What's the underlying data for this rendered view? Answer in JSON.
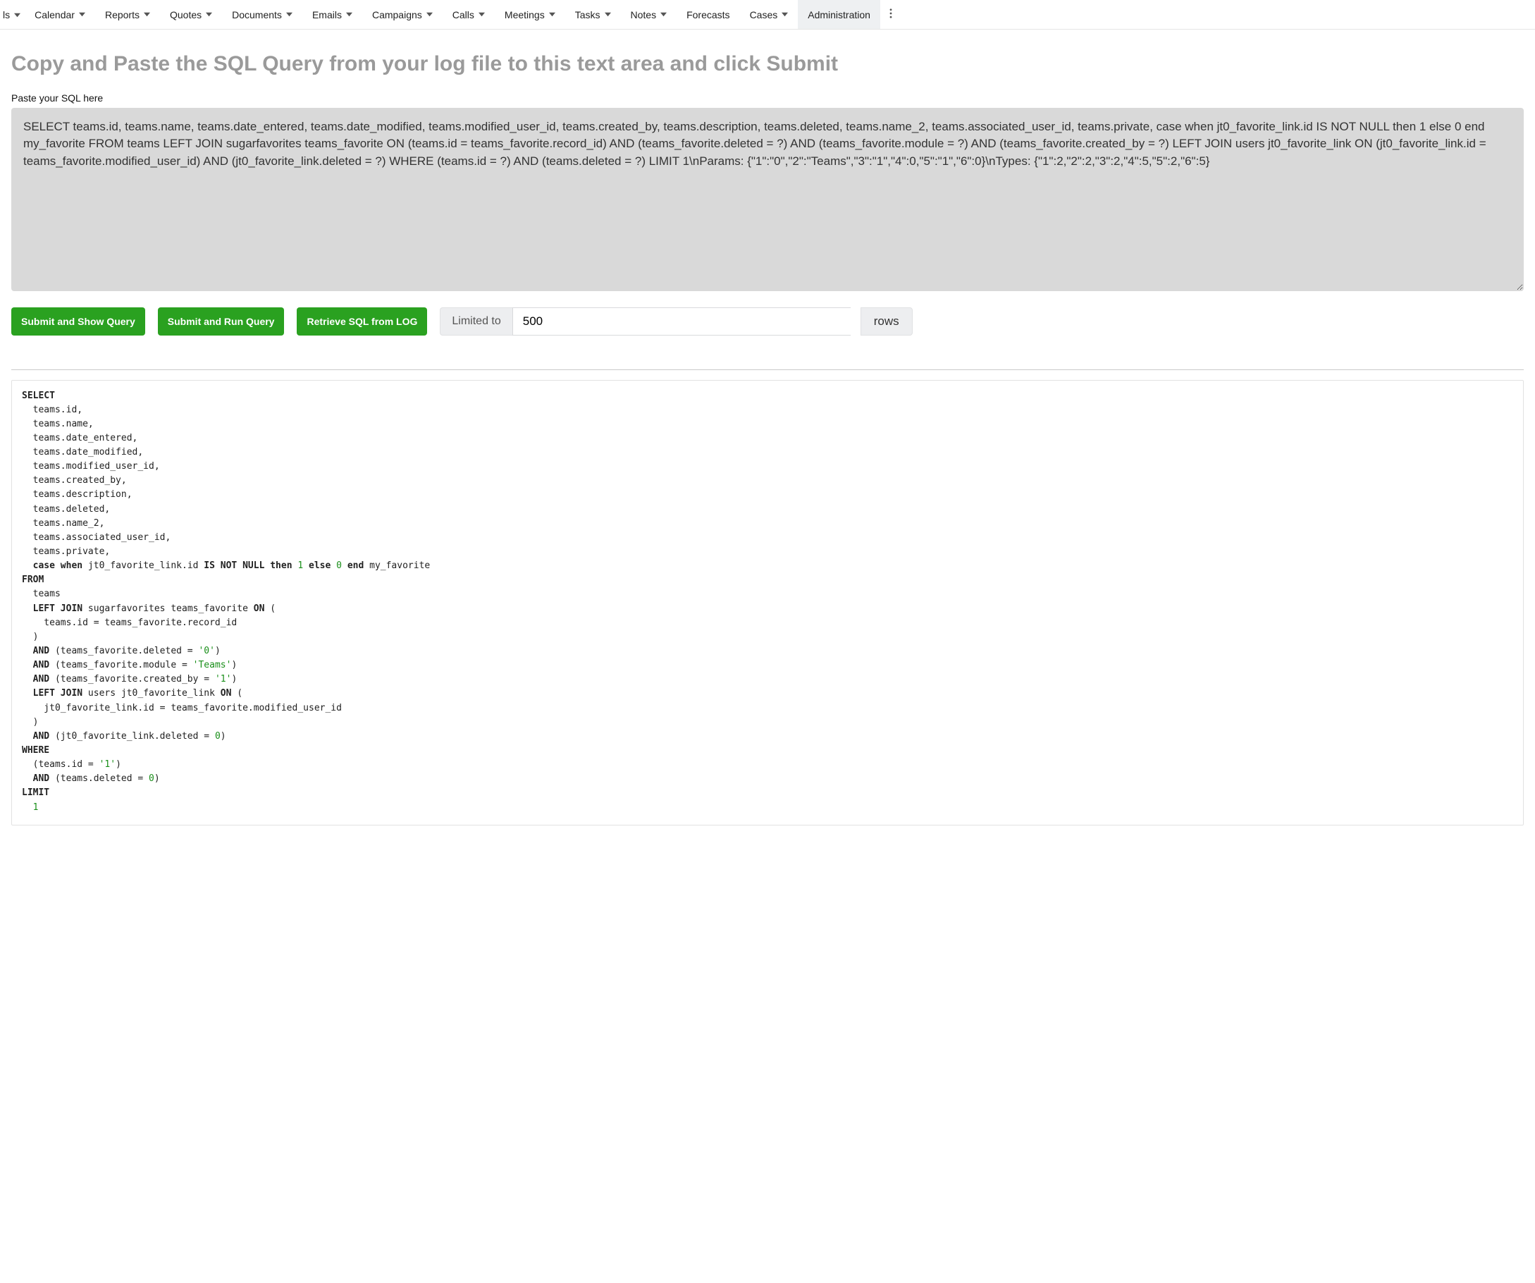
{
  "nav": {
    "partial": "ls",
    "items": [
      {
        "label": "Calendar",
        "caret": true
      },
      {
        "label": "Reports",
        "caret": true
      },
      {
        "label": "Quotes",
        "caret": true
      },
      {
        "label": "Documents",
        "caret": true
      },
      {
        "label": "Emails",
        "caret": true
      },
      {
        "label": "Campaigns",
        "caret": true
      },
      {
        "label": "Calls",
        "caret": true
      },
      {
        "label": "Meetings",
        "caret": true
      },
      {
        "label": "Tasks",
        "caret": true
      },
      {
        "label": "Notes",
        "caret": true
      },
      {
        "label": "Forecasts",
        "caret": false
      },
      {
        "label": "Cases",
        "caret": true
      },
      {
        "label": "Administration",
        "caret": false,
        "active": true
      }
    ]
  },
  "header": {
    "title": "Copy and Paste the SQL Query from your log file to this text area and click Submit"
  },
  "field": {
    "label": "Paste your SQL here",
    "value": "SELECT teams.id, teams.name, teams.date_entered, teams.date_modified, teams.modified_user_id, teams.created_by, teams.description, teams.deleted, teams.name_2, teams.associated_user_id, teams.private, case when jt0_favorite_link.id IS NOT NULL then 1 else 0 end my_favorite FROM teams LEFT JOIN sugarfavorites teams_favorite ON (teams.id = teams_favorite.record_id) AND (teams_favorite.deleted = ?) AND (teams_favorite.module = ?) AND (teams_favorite.created_by = ?) LEFT JOIN users jt0_favorite_link ON (jt0_favorite_link.id = teams_favorite.modified_user_id) AND (jt0_favorite_link.deleted = ?) WHERE (teams.id = ?) AND (teams.deleted = ?) LIMIT 1\\nParams: {\"1\":\"0\",\"2\":\"Teams\",\"3\":\"1\",\"4\":0,\"5\":\"1\",\"6\":0}\\nTypes: {\"1\":2,\"2\":2,\"3\":2,\"4\":5,\"5\":2,\"6\":5}"
  },
  "actions": {
    "submit_show": "Submit and Show Query",
    "submit_run": "Submit and Run Query",
    "retrieve": "Retrieve SQL from LOG",
    "limited_to": "Limited to",
    "limit_value": "500",
    "rows": "rows"
  },
  "sql_output": {
    "line1": "SELECT",
    "cols": [
      "  teams.id,",
      "  teams.name,",
      "  teams.date_entered,",
      "  teams.date_modified,",
      "  teams.modified_user_id,",
      "  teams.created_by,",
      "  teams.description,",
      "  teams.deleted,",
      "  teams.name_2,",
      "  teams.associated_user_id,",
      "  teams.private,"
    ],
    "case_prefix": "  ",
    "case_kw1": "case when",
    "case_mid": " jt0_favorite_link.id ",
    "case_kw2": "IS NOT NULL then",
    "case_sp": " ",
    "case_num1": "1",
    "case_kw3": "else",
    "case_num0": "0",
    "case_kw4": "end",
    "case_rest": " my_favorite",
    "from_kw": "FROM",
    "from_tbl": "  teams",
    "lj1_kw1": "LEFT JOIN",
    "lj1_mid": " sugarfavorites teams_favorite ",
    "lj1_kw2": "ON",
    "lj1_open": " (",
    "lj1_on1": "    teams.id = teams_favorite.record_id",
    "lj1_close": "  )",
    "and_kw": "AND",
    "and1_txt": " (teams_favorite.deleted = ",
    "and1_val": "'0'",
    "and1_close": ")",
    "and2_txt": " (teams_favorite.module = ",
    "and2_val": "'Teams'",
    "and2_close": ")",
    "and3_txt": " (teams_favorite.created_by = ",
    "and3_val": "'1'",
    "and3_close": ")",
    "lj2_mid": " users jt0_favorite_link ",
    "lj2_open": " (",
    "lj2_on1": "    jt0_favorite_link.id = teams_favorite.modified_user_id",
    "lj2_close": "  )",
    "and4_txt": " (jt0_favorite_link.deleted = ",
    "and4_val": "0",
    "and4_close": ")",
    "where_kw": "WHERE",
    "where1_txt": "  (teams.id = ",
    "where1_val": "'1'",
    "where1_close": ")",
    "where2_txt": " (teams.deleted = ",
    "where2_val": "0",
    "where2_close": ")",
    "limit_kw": "LIMIT",
    "limit_val": "1"
  }
}
